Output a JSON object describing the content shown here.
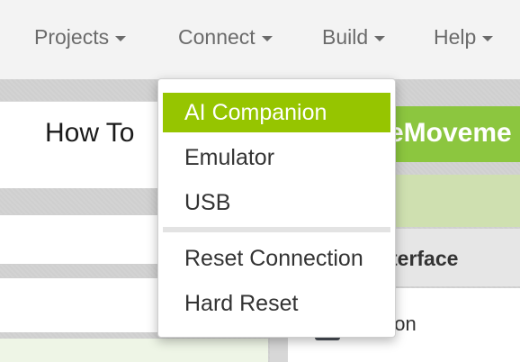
{
  "menubar": {
    "items": [
      {
        "label": "Projects"
      },
      {
        "label": "Connect"
      },
      {
        "label": "Build"
      },
      {
        "label": "Help"
      }
    ]
  },
  "left_panel": {
    "title": "How To"
  },
  "right_panel": {
    "title": "eMoveme",
    "interface_label": "terface",
    "button_label": "tton"
  },
  "connect_dropdown": {
    "items": [
      {
        "label": "AI Companion",
        "active": true
      },
      {
        "label": "Emulator"
      },
      {
        "label": "USB"
      },
      {
        "label": "Reset Connection"
      },
      {
        "label": "Hard Reset"
      }
    ]
  },
  "colors": {
    "active_item": "#96c500",
    "header_green": "#8cc63f"
  }
}
